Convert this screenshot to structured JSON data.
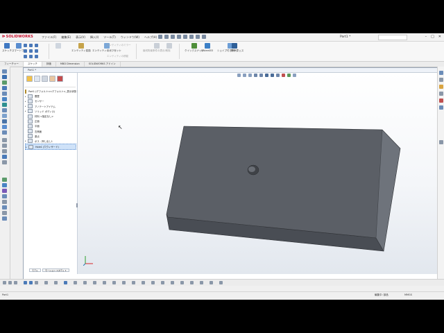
{
  "app": {
    "logo_text": "SOLIDWORKS",
    "document_title": "Part1 *",
    "window_buttons": [
      "–",
      "□",
      "✕"
    ]
  },
  "menu": [
    "ファイル(F)",
    "編集(E)",
    "表示(V)",
    "挿入(I)",
    "ツール(T)",
    "ウィンドウ(W)",
    "ヘルプ(H)"
  ],
  "ribbon": {
    "buttons": [
      {
        "label": "スケッチ"
      },
      {
        "label": "スマート寸法"
      },
      {
        "label": "エンティティ変換"
      },
      {
        "label": "エンティティのオフセット"
      },
      {
        "label": "エンティティ"
      },
      {
        "label": "サーフェス上のオフセット"
      },
      {
        "label": "エンティティのミラー"
      },
      {
        "label": "直線パターン"
      },
      {
        "label": "エンティティの移動"
      },
      {
        "label": "幾何拘束条件の表示/削除"
      },
      {
        "label": "クイックスナップ"
      },
      {
        "label": "ラピッドスケッチ"
      },
      {
        "label": "Instant2D"
      },
      {
        "label": "シェイプ付きサーフェス"
      },
      {
        "label": "関係式"
      }
    ]
  },
  "command_tabs": [
    "フィーチャー",
    "スケッチ",
    "評価",
    "MBD Dimension",
    "SOLIDWORKS アドイン"
  ],
  "doc_tab_label": "Part1 *",
  "tree": {
    "root": "Part1 (デフォルト<<デフォルト>_表示状態 1>)",
    "items": [
      {
        "label": "履歴",
        "expandable": true
      },
      {
        "label": "センサー",
        "expandable": true
      },
      {
        "label": "アノテートアイテム",
        "expandable": true
      },
      {
        "label": "ソリッド ボディ(1)",
        "expandable": true
      },
      {
        "label": "材料 <指定なし>",
        "expandable": false
      },
      {
        "label": "正面",
        "expandable": false
      },
      {
        "label": "平面",
        "expandable": false
      },
      {
        "label": "右側面",
        "expandable": false
      },
      {
        "label": "原点",
        "expandable": false
      },
      {
        "label": "ボス - 押し出し1",
        "expandable": true
      },
      {
        "label": "Hole1 (穴ウィザード)",
        "expandable": true,
        "selected": true
      }
    ]
  },
  "fm_bottom_tabs": [
    "モデル",
    "モーション スタディ 1"
  ],
  "status": {
    "left": "Part1",
    "unit_label": "編集中: 部品",
    "units": "MMGS"
  },
  "colors": {
    "model_top": "#5b5f66",
    "model_front": "#4a4e55",
    "model_right": "#6e737b",
    "selection": "#cfe2f8",
    "brand": "#c8102e"
  }
}
